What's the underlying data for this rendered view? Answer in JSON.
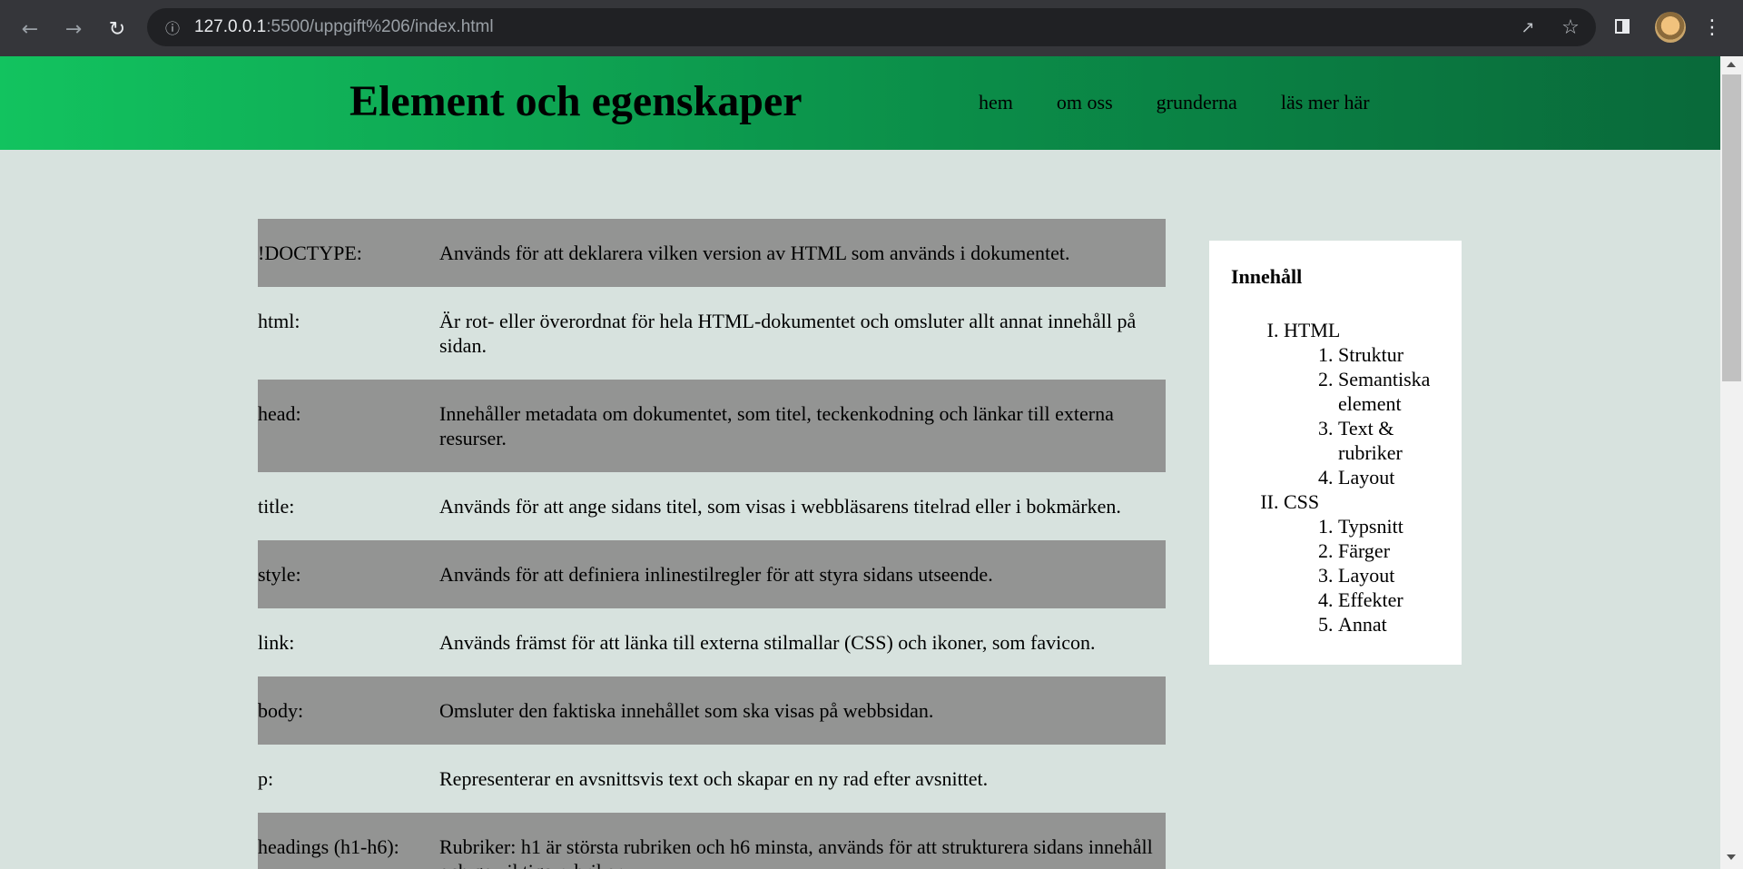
{
  "browser": {
    "url_host": "127.0.0.1",
    "url_rest": ":5500/uppgift%206/index.html",
    "icons": [
      "back-icon",
      "forward-icon",
      "reload-icon",
      "info-icon",
      "share-icon",
      "star-icon",
      "side-panel-icon",
      "avatar",
      "menu-icon"
    ]
  },
  "header": {
    "title": "Element och egenskaper",
    "nav": [
      "hem",
      "om oss",
      "grunderna",
      "läs mer här"
    ]
  },
  "definitions": [
    {
      "term": "!DOCTYPE:",
      "desc": "Används för att deklarera vilken version av HTML som används i dokumentet."
    },
    {
      "term": "html:",
      "desc": "Är rot- eller överordnat för hela HTML-dokumentet och omsluter allt annat innehåll på sidan."
    },
    {
      "term": "head:",
      "desc": "Innehåller metadata om dokumentet, som titel, teckenkodning och länkar till externa resurser."
    },
    {
      "term": "title:",
      "desc": "Används för att ange sidans titel, som visas i webbläsarens titelrad eller i bokmärken."
    },
    {
      "term": "style:",
      "desc": "Används för att definiera inlinestilregler för att styra sidans utseende."
    },
    {
      "term": "link:",
      "desc": "Används främst för att länka till externa stilmallar (CSS) och ikoner, som favicon."
    },
    {
      "term": "body:",
      "desc": "Omsluter den faktiska innehållet som ska visas på webbsidan."
    },
    {
      "term": "p:",
      "desc": "Representerar en avsnittsvis text och skapar en ny rad efter avsnittet."
    },
    {
      "term": "headings (h1-h6):",
      "desc": "Rubriker: h1 är största rubriken och h6 minsta, används för att strukturera sidans innehåll och ge viktiga rubriker."
    }
  ],
  "toc": {
    "title": "Innehåll",
    "sections": [
      {
        "label": "HTML",
        "items": [
          "Struktur",
          "Semantiska element",
          "Text & rubriker",
          "Layout"
        ]
      },
      {
        "label": "CSS",
        "items": [
          "Typsnitt",
          "Färger",
          "Layout",
          "Effekter",
          "Annat"
        ]
      }
    ]
  },
  "colors": {
    "header_gradient": [
      "#12c35f",
      "#09693a"
    ],
    "page_bg": "#d7e2de",
    "row_shade": "#939493",
    "toc_bg": "#ffffff"
  }
}
